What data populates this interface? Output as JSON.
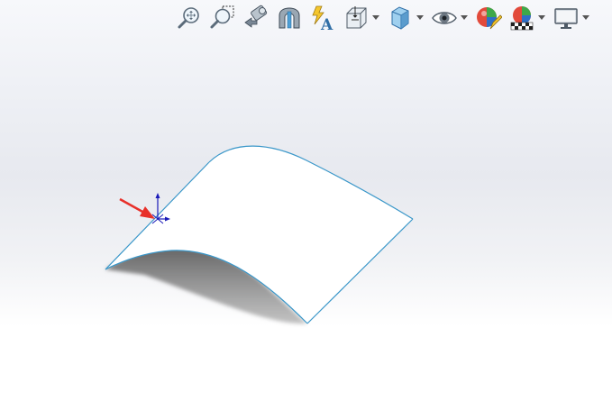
{
  "toolbar": {
    "items": [
      {
        "name": "zoom-to-fit",
        "icon": "zoom-to-fit-icon",
        "dropdown": false
      },
      {
        "name": "zoom-to-area",
        "icon": "zoom-to-area-icon",
        "dropdown": false
      },
      {
        "name": "previous-view",
        "icon": "previous-view-icon",
        "dropdown": false
      },
      {
        "name": "section-view",
        "icon": "section-view-icon",
        "dropdown": false
      },
      {
        "name": "dynamic-annotation-views",
        "icon": "dynamic-annotation-icon",
        "dropdown": false
      },
      {
        "name": "view-orientation",
        "icon": "view-orientation-icon",
        "dropdown": true
      },
      {
        "name": "display-style",
        "icon": "display-style-icon",
        "dropdown": true
      },
      {
        "name": "hide-show-items",
        "icon": "eye-icon",
        "dropdown": true
      },
      {
        "name": "edit-appearance",
        "icon": "edit-appearance-icon",
        "dropdown": false
      },
      {
        "name": "apply-scene",
        "icon": "apply-scene-icon",
        "dropdown": true
      },
      {
        "name": "view-settings",
        "icon": "monitor-icon",
        "dropdown": true
      }
    ]
  },
  "scene": {
    "surface_fill": "#ffffff",
    "edge_color": "#3a97c9",
    "shadow_color": "#8a8a8a",
    "origin_color": "#1a1ab8",
    "pointer_color": "#e8302a"
  }
}
